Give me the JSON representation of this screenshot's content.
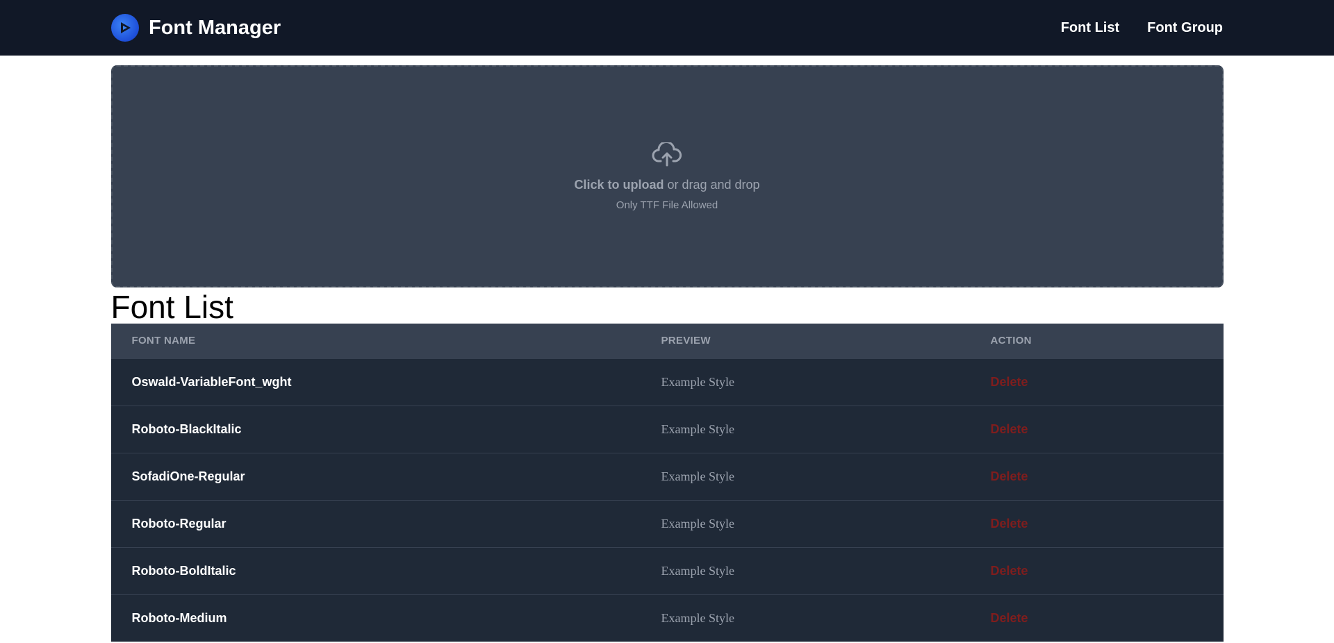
{
  "app": {
    "title": "Font Manager",
    "nav": [
      {
        "label": "Font List"
      },
      {
        "label": "Font Group"
      }
    ]
  },
  "upload": {
    "click_label": "Click to upload",
    "drag_label": " or drag and drop",
    "hint": "Only TTF File Allowed",
    "icon": "cloud-upload-icon"
  },
  "font_list": {
    "title": "Font List",
    "columns": [
      "FONT NAME",
      "PREVIEW",
      "ACTION"
    ],
    "rows": [
      {
        "name": "Oswald-VariableFont_wght",
        "preview": "Example Style",
        "action": "Delete"
      },
      {
        "name": "Roboto-BlackItalic",
        "preview": "Example Style",
        "action": "Delete"
      },
      {
        "name": "SofadiOne-Regular",
        "preview": "Example Style",
        "action": "Delete"
      },
      {
        "name": "Roboto-Regular",
        "preview": "Example Style",
        "action": "Delete"
      },
      {
        "name": "Roboto-BoldItalic",
        "preview": "Example Style",
        "action": "Delete"
      },
      {
        "name": "Roboto-Medium",
        "preview": "Example Style",
        "action": "Delete"
      }
    ]
  },
  "colors": {
    "navbar": "#111827",
    "dropzone": "#374151",
    "table_header": "#374151",
    "table_row": "#1f2937",
    "delete": "#7f1d1d"
  }
}
